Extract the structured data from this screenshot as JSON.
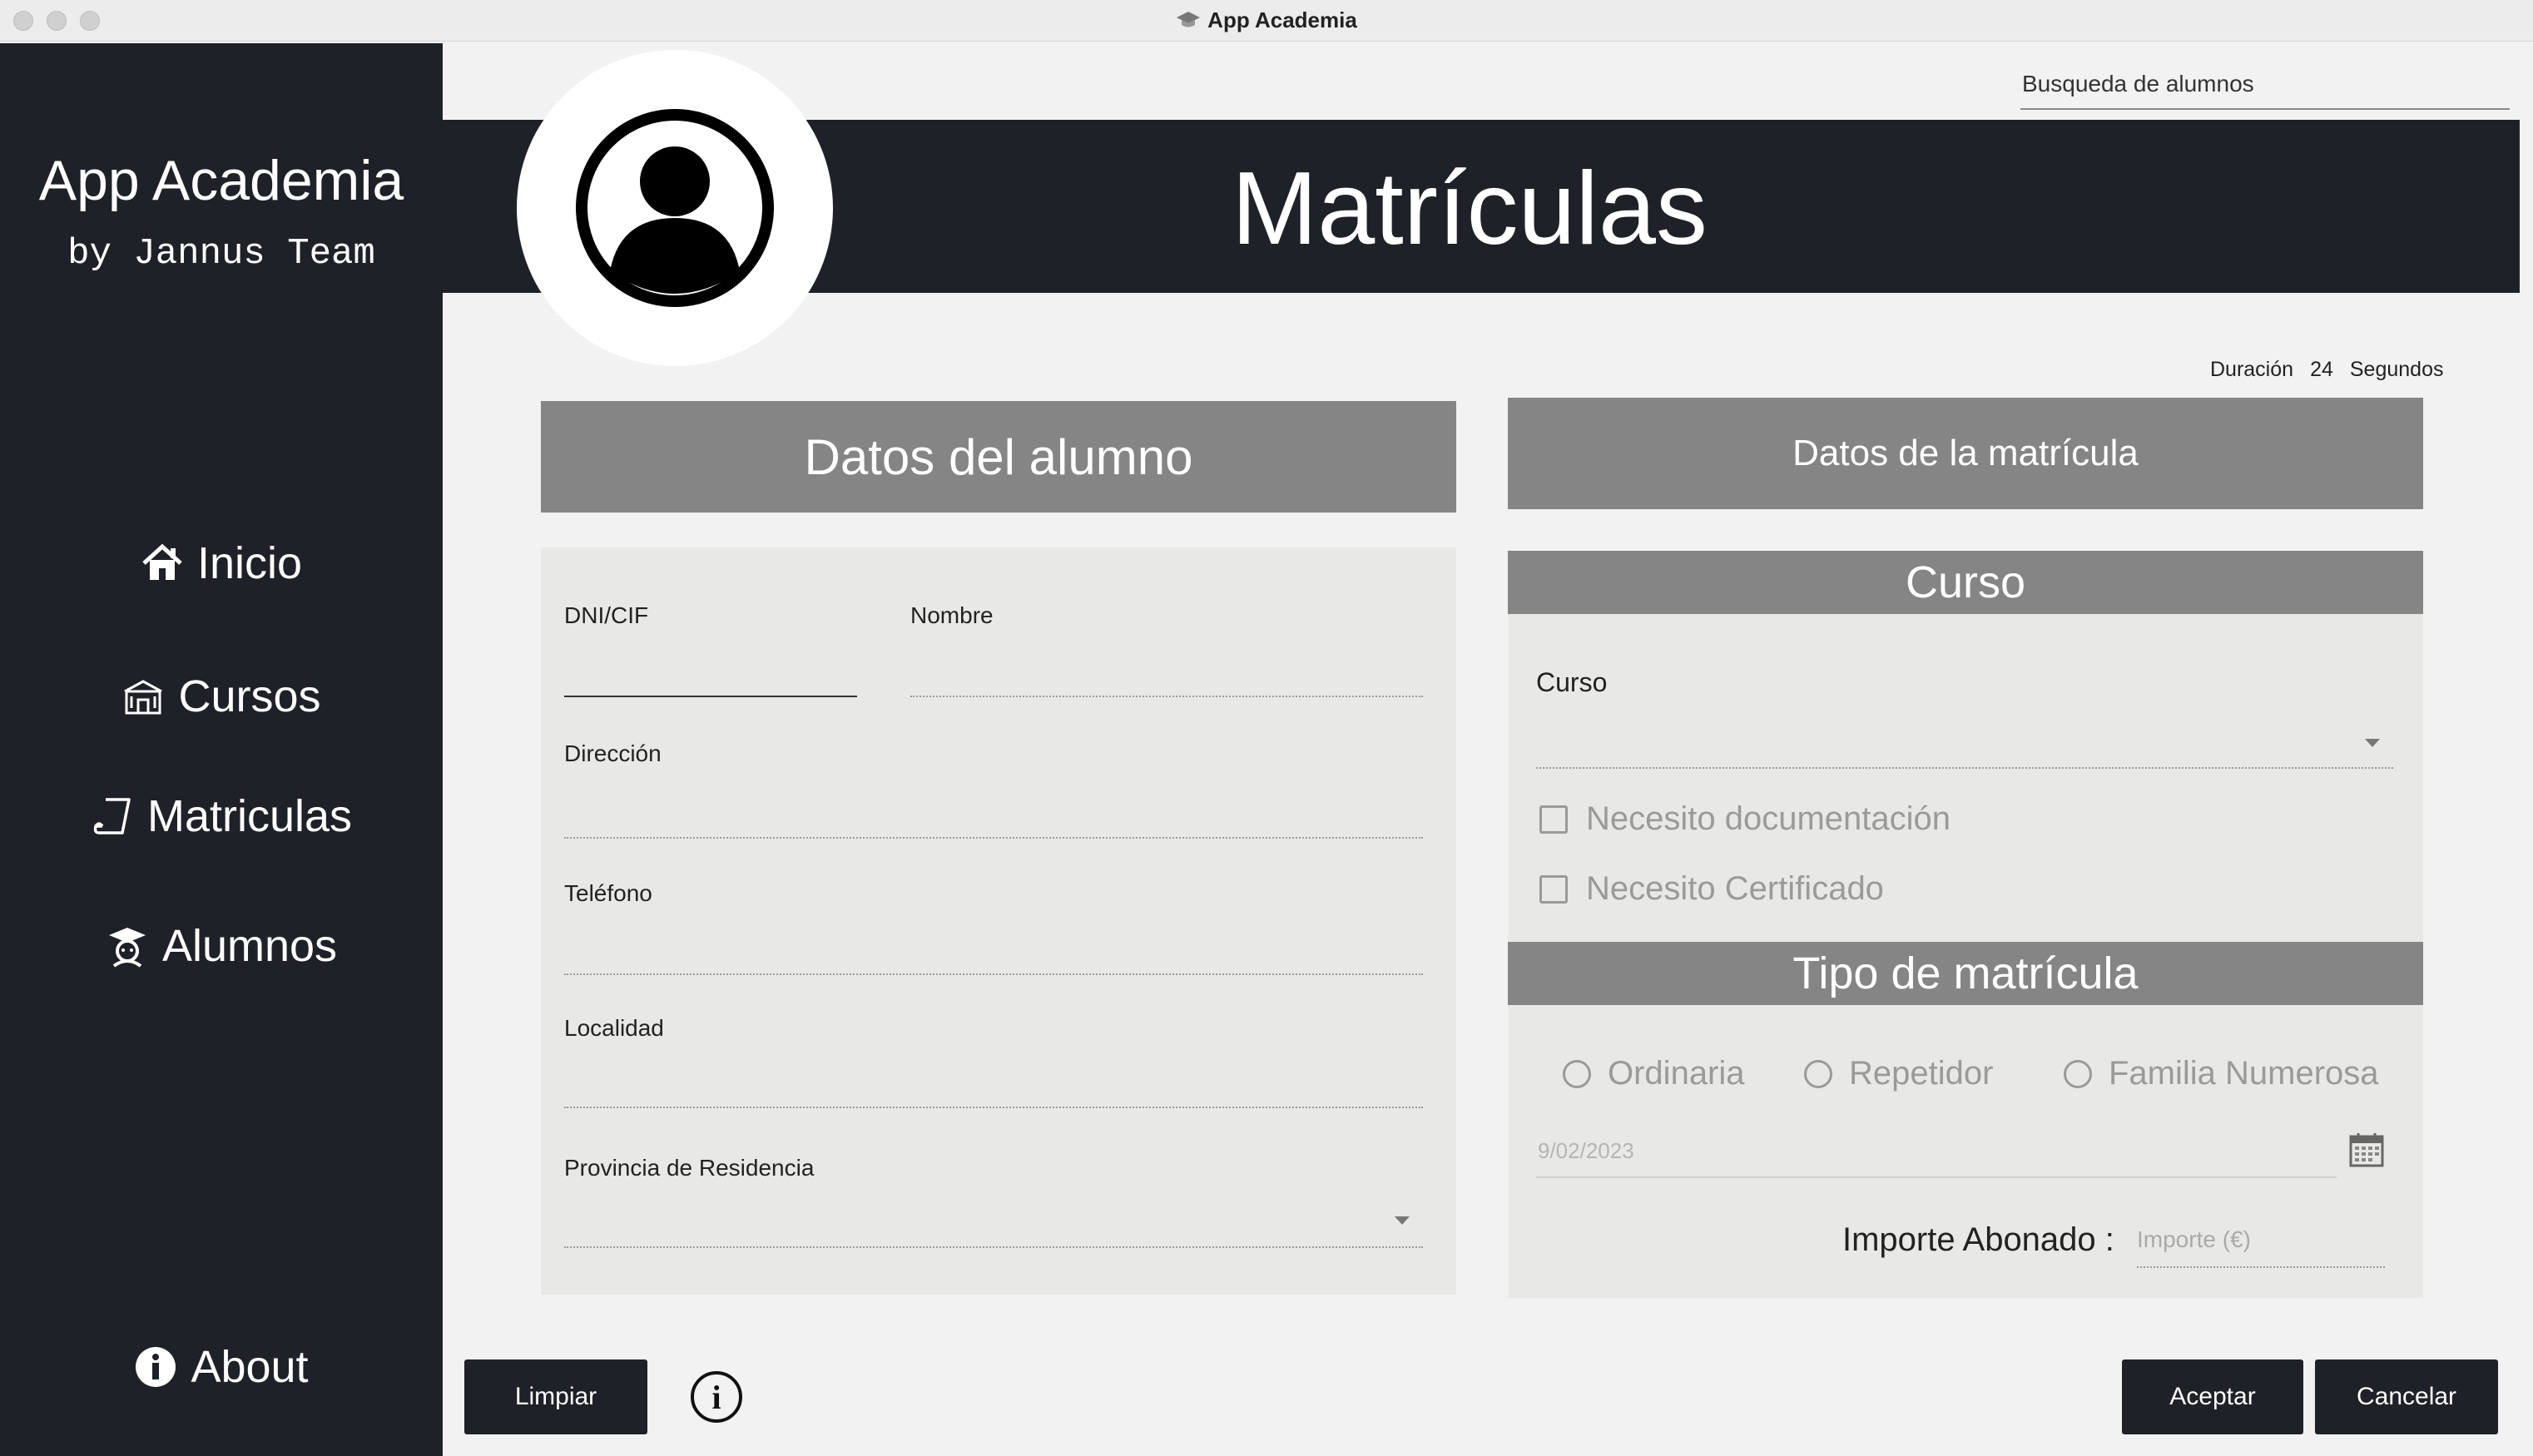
{
  "window": {
    "title": "App Academia"
  },
  "sidebar": {
    "brand_name": "App Academia",
    "brand_sub": "by Jannus Team",
    "items": [
      {
        "label": "Inicio",
        "icon": "home-icon"
      },
      {
        "label": "Cursos",
        "icon": "school-building-icon"
      },
      {
        "label": "Matriculas",
        "icon": "enrollment-note-icon"
      },
      {
        "label": "Alumnos",
        "icon": "student-icon"
      }
    ],
    "about": {
      "label": "About",
      "icon": "info-filled-icon"
    }
  },
  "header": {
    "title": "Matrículas",
    "search_placeholder": "Busqueda de alumnos"
  },
  "duration": {
    "label": "Duración",
    "value": "24",
    "unit": "Segundos"
  },
  "student": {
    "heading": "Datos del alumno",
    "dni_label": "DNI/CIF",
    "nombre_label": "Nombre",
    "direccion_label": "Dirección",
    "telefono_label": "Teléfono",
    "localidad_label": "Localidad",
    "provincia_label": "Provincia de Residencia"
  },
  "enrollment": {
    "heading": "Datos de la matrícula",
    "curso_section": "Curso",
    "curso_label": "Curso",
    "check_doc": "Necesito documentación",
    "check_cert": "Necesito Certificado",
    "tipo_section": "Tipo de matrícula",
    "radio_ordinaria": "Ordinaria",
    "radio_repetidor": "Repetidor",
    "radio_familia": "Familia Numerosa",
    "date_value": "9/02/2023",
    "importe_label": "Importe Abonado :",
    "importe_placeholder": "Importe (€)"
  },
  "buttons": {
    "limpiar": "Limpiar",
    "info": "i",
    "aceptar": "Aceptar",
    "cancelar": "Cancelar"
  },
  "colors": {
    "dark": "#1e2127",
    "panel_head": "#858585",
    "panel_body": "#e8e8e6",
    "background": "#f2f2f2"
  }
}
